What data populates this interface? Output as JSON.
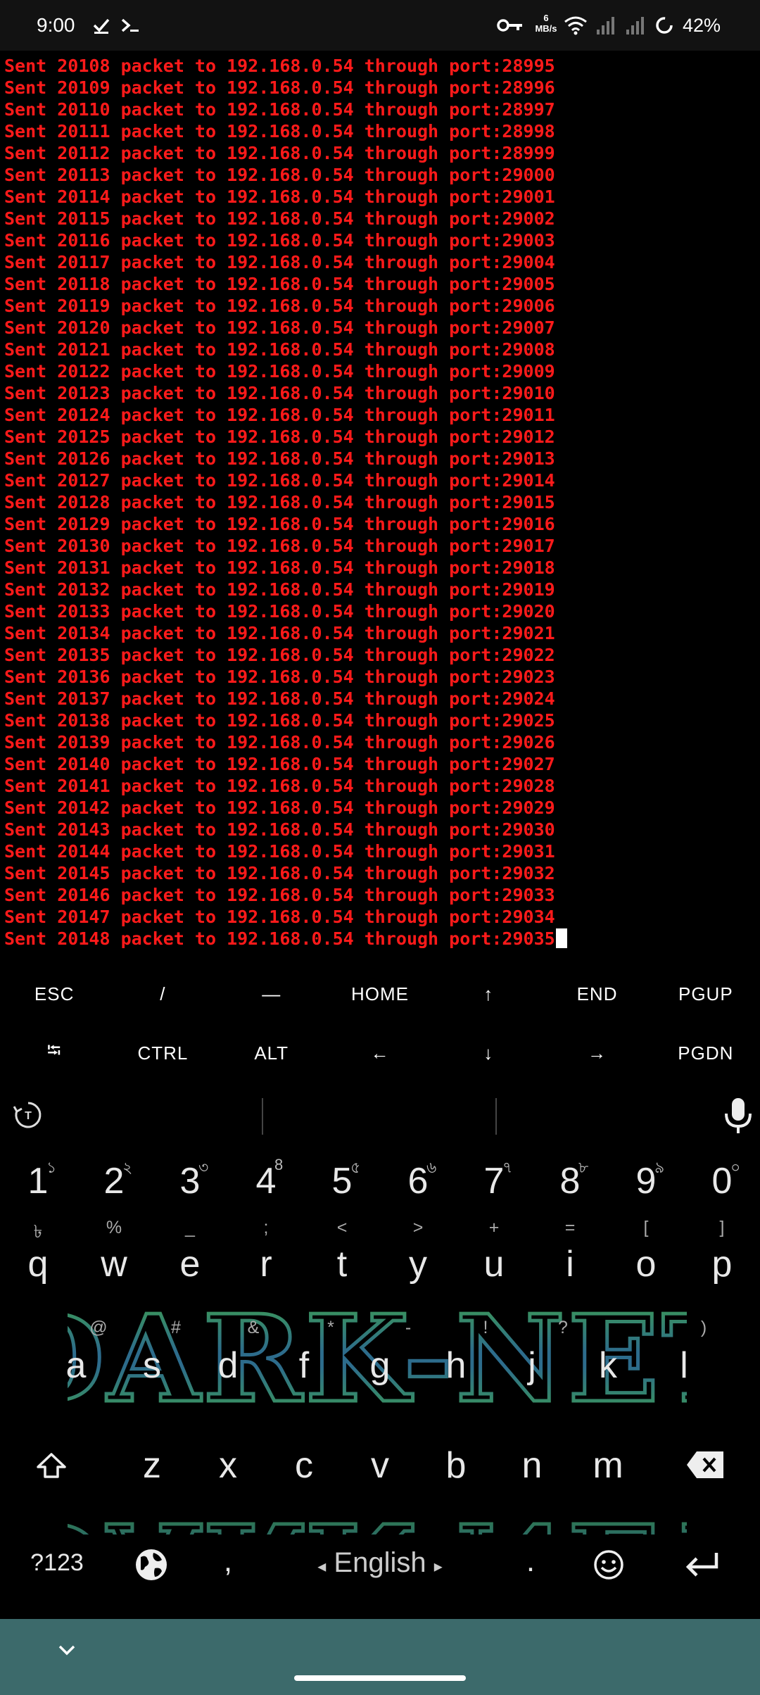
{
  "status_bar": {
    "time": "9:00",
    "net_speed_value": "6",
    "net_speed_unit": "MB/s",
    "battery": "42%",
    "icons": [
      "check-icon",
      "terminal-icon",
      "key-icon",
      "wifi-icon",
      "signal-icon",
      "signal-icon",
      "battery-saver-icon"
    ]
  },
  "terminal": {
    "text_color": "#ff1a1a",
    "lines": [
      "Sent 20108 packet to 192.168.0.54 through port:28995",
      "Sent 20109 packet to 192.168.0.54 through port:28996",
      "Sent 20110 packet to 192.168.0.54 through port:28997",
      "Sent 20111 packet to 192.168.0.54 through port:28998",
      "Sent 20112 packet to 192.168.0.54 through port:28999",
      "Sent 20113 packet to 192.168.0.54 through port:29000",
      "Sent 20114 packet to 192.168.0.54 through port:29001",
      "Sent 20115 packet to 192.168.0.54 through port:29002",
      "Sent 20116 packet to 192.168.0.54 through port:29003",
      "Sent 20117 packet to 192.168.0.54 through port:29004",
      "Sent 20118 packet to 192.168.0.54 through port:29005",
      "Sent 20119 packet to 192.168.0.54 through port:29006",
      "Sent 20120 packet to 192.168.0.54 through port:29007",
      "Sent 20121 packet to 192.168.0.54 through port:29008",
      "Sent 20122 packet to 192.168.0.54 through port:29009",
      "Sent 20123 packet to 192.168.0.54 through port:29010",
      "Sent 20124 packet to 192.168.0.54 through port:29011",
      "Sent 20125 packet to 192.168.0.54 through port:29012",
      "Sent 20126 packet to 192.168.0.54 through port:29013",
      "Sent 20127 packet to 192.168.0.54 through port:29014",
      "Sent 20128 packet to 192.168.0.54 through port:29015",
      "Sent 20129 packet to 192.168.0.54 through port:29016",
      "Sent 20130 packet to 192.168.0.54 through port:29017",
      "Sent 20131 packet to 192.168.0.54 through port:29018",
      "Sent 20132 packet to 192.168.0.54 through port:29019",
      "Sent 20133 packet to 192.168.0.54 through port:29020",
      "Sent 20134 packet to 192.168.0.54 through port:29021",
      "Sent 20135 packet to 192.168.0.54 through port:29022",
      "Sent 20136 packet to 192.168.0.54 through port:29023",
      "Sent 20137 packet to 192.168.0.54 through port:29024",
      "Sent 20138 packet to 192.168.0.54 through port:29025",
      "Sent 20139 packet to 192.168.0.54 through port:29026",
      "Sent 20140 packet to 192.168.0.54 through port:29027",
      "Sent 20141 packet to 192.168.0.54 through port:29028",
      "Sent 20142 packet to 192.168.0.54 through port:29029",
      "Sent 20143 packet to 192.168.0.54 through port:29030",
      "Sent 20144 packet to 192.168.0.54 through port:29031",
      "Sent 20145 packet to 192.168.0.54 through port:29032",
      "Sent 20146 packet to 192.168.0.54 through port:29033",
      "Sent 20147 packet to 192.168.0.54 through port:29034",
      "Sent 20148 packet to 192.168.0.54 through port:29035"
    ]
  },
  "extra_keys": {
    "row1": [
      "ESC",
      "/",
      "—",
      "HOME",
      "↑",
      "END",
      "PGUP"
    ],
    "row2": [
      "⭾",
      "CTRL",
      "ALT",
      "←",
      "↓",
      "→",
      "PGDN"
    ]
  },
  "keyboard": {
    "theme_art_text": "DARK-NET",
    "number_row": [
      {
        "key": "1",
        "hint": "১"
      },
      {
        "key": "2",
        "hint": "২"
      },
      {
        "key": "3",
        "hint": "৩"
      },
      {
        "key": "4",
        "hint": "8"
      },
      {
        "key": "5",
        "hint": "৫"
      },
      {
        "key": "6",
        "hint": "৬"
      },
      {
        "key": "7",
        "hint": "৭"
      },
      {
        "key": "8",
        "hint": "৮"
      },
      {
        "key": "9",
        "hint": "৯"
      },
      {
        "key": "0",
        "hint": "০"
      }
    ],
    "symbol_hints_row1": [
      "৳",
      "%",
      "_",
      ";",
      "<",
      ">",
      "+",
      "=",
      "[",
      "]"
    ],
    "row_q": [
      "q",
      "w",
      "e",
      "r",
      "t",
      "y",
      "u",
      "i",
      "o",
      "p"
    ],
    "symbol_hints_row2": [
      "@",
      "#",
      "&",
      "*",
      "-",
      "!",
      "?",
      ")"
    ],
    "row_a": [
      "a",
      "s",
      "d",
      "f",
      "g",
      "h",
      "j",
      "k",
      "l"
    ],
    "row_z": [
      "z",
      "x",
      "c",
      "v",
      "b",
      "n",
      "m"
    ],
    "bottom": {
      "symbols": "?123",
      "comma": ",",
      "space": "English",
      "period": "."
    }
  },
  "colors": {
    "nav_bar": "#3c6a6b",
    "status_bar": "#121212"
  }
}
